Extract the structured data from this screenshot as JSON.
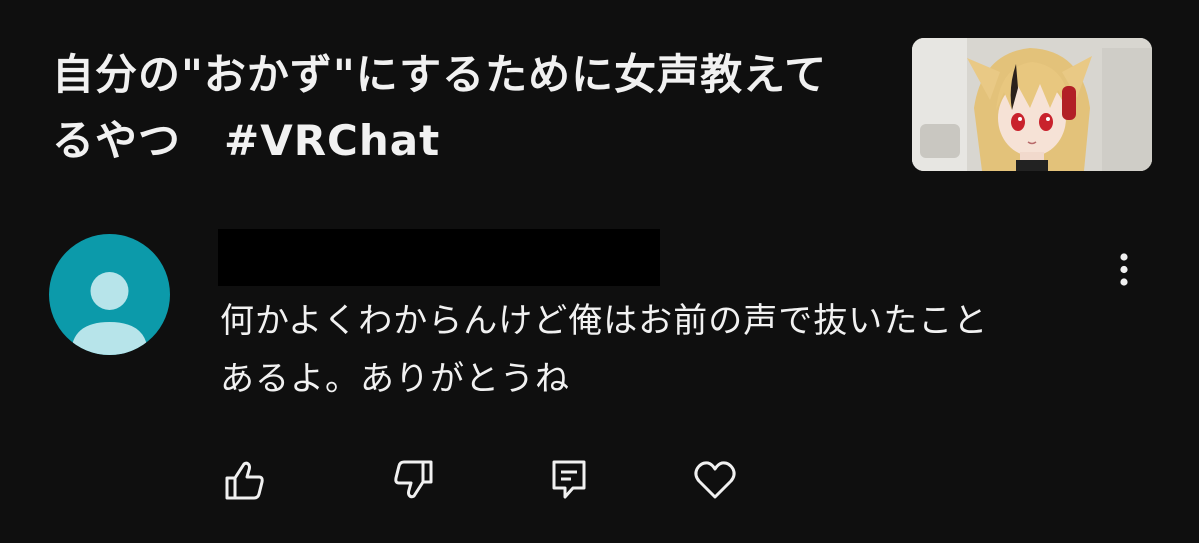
{
  "video": {
    "title_line1": "自分の\"おかず\"にするために女声教えて",
    "title_line2": "るやつ　#VRChat",
    "thumbnail_icon": "anime-avatar-thumbnail"
  },
  "comment": {
    "avatar_icon": "default-user-avatar",
    "author": "",
    "text_line1": "何かよくわからんけど俺はお前の声で抜いたこと",
    "text_line2": "あるよ。ありがとうね",
    "actions": {
      "like_icon": "thumbs-up-icon",
      "dislike_icon": "thumbs-down-icon",
      "reply_icon": "comment-reply-icon",
      "heart_icon": "heart-icon",
      "more_icon": "more-vertical-icon"
    }
  },
  "colors": {
    "background": "#0f0f0f",
    "text": "#f1f1f1",
    "avatar": "#0c9aaa",
    "avatar_figure": "#b7e4ea"
  }
}
